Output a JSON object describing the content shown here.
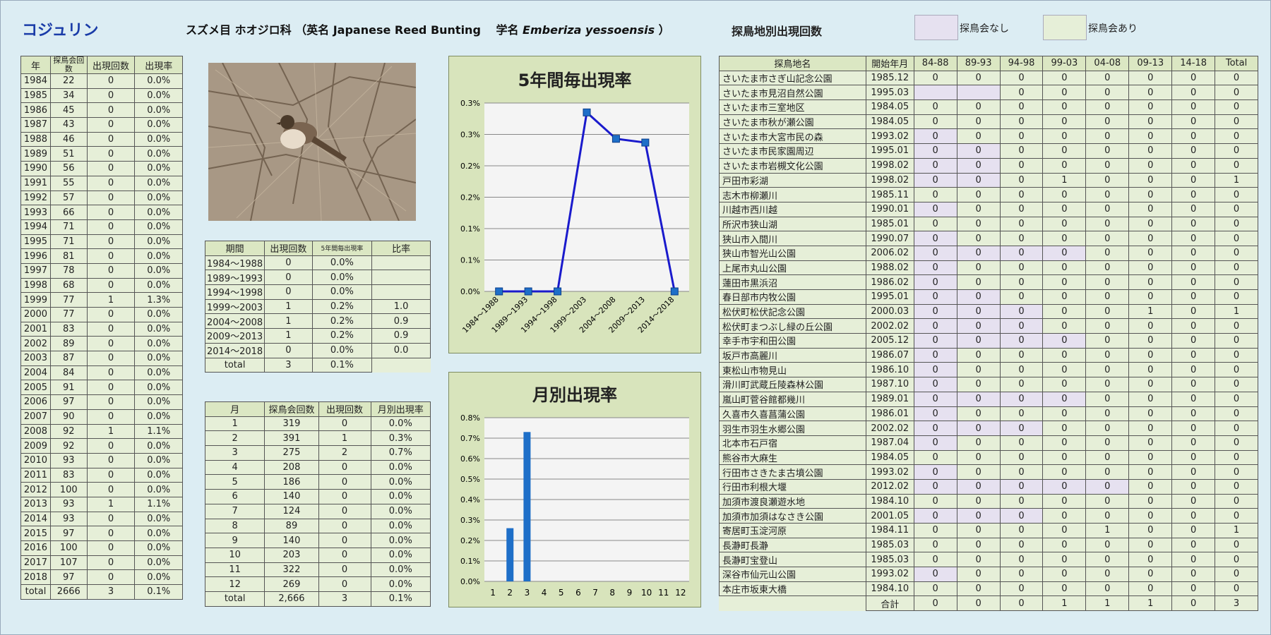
{
  "header": {
    "title": "コジュリン",
    "species_prefix": "スズメ目 ホオジロ科 （英名 Japanese Reed Bunting　 学名 ",
    "species_latin": "Emberiza yessoensis",
    "species_suffix": " ）",
    "loc_title": "探鳥地別出現回数",
    "legend_none": "探鳥会なし",
    "legend_yes": "探鳥会あり"
  },
  "colors": {
    "background": "#dcedf3",
    "table_cell": "#e6efd8",
    "no_survey": "#e6e1f0",
    "line": "#1a1acc",
    "marker": "#1e6fc8",
    "bar": "#1e6fc8",
    "panel": "#d8e4bc"
  },
  "year_table": {
    "headers": [
      "年",
      "探鳥会回数",
      "出現回数",
      "出現率"
    ],
    "rows": [
      [
        "1984",
        "22",
        "0",
        "0.0%"
      ],
      [
        "1985",
        "34",
        "0",
        "0.0%"
      ],
      [
        "1986",
        "45",
        "0",
        "0.0%"
      ],
      [
        "1987",
        "43",
        "0",
        "0.0%"
      ],
      [
        "1988",
        "46",
        "0",
        "0.0%"
      ],
      [
        "1989",
        "51",
        "0",
        "0.0%"
      ],
      [
        "1990",
        "56",
        "0",
        "0.0%"
      ],
      [
        "1991",
        "55",
        "0",
        "0.0%"
      ],
      [
        "1992",
        "57",
        "0",
        "0.0%"
      ],
      [
        "1993",
        "66",
        "0",
        "0.0%"
      ],
      [
        "1994",
        "71",
        "0",
        "0.0%"
      ],
      [
        "1995",
        "71",
        "0",
        "0.0%"
      ],
      [
        "1996",
        "81",
        "0",
        "0.0%"
      ],
      [
        "1997",
        "78",
        "0",
        "0.0%"
      ],
      [
        "1998",
        "68",
        "0",
        "0.0%"
      ],
      [
        "1999",
        "77",
        "1",
        "1.3%"
      ],
      [
        "2000",
        "77",
        "0",
        "0.0%"
      ],
      [
        "2001",
        "83",
        "0",
        "0.0%"
      ],
      [
        "2002",
        "89",
        "0",
        "0.0%"
      ],
      [
        "2003",
        "87",
        "0",
        "0.0%"
      ],
      [
        "2004",
        "84",
        "0",
        "0.0%"
      ],
      [
        "2005",
        "91",
        "0",
        "0.0%"
      ],
      [
        "2006",
        "97",
        "0",
        "0.0%"
      ],
      [
        "2007",
        "90",
        "0",
        "0.0%"
      ],
      [
        "2008",
        "92",
        "1",
        "1.1%"
      ],
      [
        "2009",
        "92",
        "0",
        "0.0%"
      ],
      [
        "2010",
        "93",
        "0",
        "0.0%"
      ],
      [
        "2011",
        "83",
        "0",
        "0.0%"
      ],
      [
        "2012",
        "100",
        "0",
        "0.0%"
      ],
      [
        "2013",
        "93",
        "1",
        "1.1%"
      ],
      [
        "2014",
        "93",
        "0",
        "0.0%"
      ],
      [
        "2015",
        "97",
        "0",
        "0.0%"
      ],
      [
        "2016",
        "100",
        "0",
        "0.0%"
      ],
      [
        "2017",
        "107",
        "0",
        "0.0%"
      ],
      [
        "2018",
        "97",
        "0",
        "0.0%"
      ],
      [
        "total",
        "2666",
        "3",
        "0.1%"
      ]
    ]
  },
  "period_table": {
    "headers": [
      "期間",
      "出現回数",
      "5年間毎出現率",
      "比率"
    ],
    "rows": [
      [
        "1984～1988",
        "0",
        "0.0%",
        ""
      ],
      [
        "1989～1993",
        "0",
        "0.0%",
        ""
      ],
      [
        "1994～1998",
        "0",
        "0.0%",
        ""
      ],
      [
        "1999～2003",
        "1",
        "0.2%",
        "1.0"
      ],
      [
        "2004～2008",
        "1",
        "0.2%",
        "0.9"
      ],
      [
        "2009～2013",
        "1",
        "0.2%",
        "0.9"
      ],
      [
        "2014～2018",
        "0",
        "0.0%",
        "0.0"
      ]
    ],
    "total": [
      "total",
      "3",
      "0.1%"
    ]
  },
  "month_table": {
    "headers": [
      "月",
      "探鳥会回数",
      "出現回数",
      "月別出現率"
    ],
    "rows": [
      [
        "1",
        "319",
        "0",
        "0.0%"
      ],
      [
        "2",
        "391",
        "1",
        "0.3%"
      ],
      [
        "3",
        "275",
        "2",
        "0.7%"
      ],
      [
        "4",
        "208",
        "0",
        "0.0%"
      ],
      [
        "5",
        "186",
        "0",
        "0.0%"
      ],
      [
        "6",
        "140",
        "0",
        "0.0%"
      ],
      [
        "7",
        "124",
        "0",
        "0.0%"
      ],
      [
        "8",
        "89",
        "0",
        "0.0%"
      ],
      [
        "9",
        "140",
        "0",
        "0.0%"
      ],
      [
        "10",
        "203",
        "0",
        "0.0%"
      ],
      [
        "11",
        "322",
        "0",
        "0.0%"
      ],
      [
        "12",
        "269",
        "0",
        "0.0%"
      ],
      [
        "total",
        "2,666",
        "3",
        "0.1%"
      ]
    ]
  },
  "location_table": {
    "headers": [
      "探鳥地名",
      "開始年月",
      "84-88",
      "89-93",
      "94-98",
      "99-03",
      "04-08",
      "09-13",
      "14-18",
      "Total"
    ],
    "rows": [
      {
        "name": "さいたま市さぎ山記念公園",
        "start": "1985.12",
        "v": [
          "0",
          "0",
          "0",
          "0",
          "0",
          "0",
          "0",
          "0"
        ],
        "p": []
      },
      {
        "name": "さいたま市見沼自然公園",
        "start": "1995.03",
        "v": [
          "",
          "",
          "0",
          "0",
          "0",
          "0",
          "0",
          "0"
        ],
        "p": [
          0,
          1
        ]
      },
      {
        "name": "さいたま市三室地区",
        "start": "1984.05",
        "v": [
          "0",
          "0",
          "0",
          "0",
          "0",
          "0",
          "0",
          "0"
        ],
        "p": []
      },
      {
        "name": "さいたま市秋が瀬公園",
        "start": "1984.05",
        "v": [
          "0",
          "0",
          "0",
          "0",
          "0",
          "0",
          "0",
          "0"
        ],
        "p": []
      },
      {
        "name": "さいたま市大宮市民の森",
        "start": "1993.02",
        "v": [
          "0",
          "0",
          "0",
          "0",
          "0",
          "0",
          "0",
          "0"
        ],
        "p": [
          0
        ]
      },
      {
        "name": "さいたま市民家園周辺",
        "start": "1995.01",
        "v": [
          "0",
          "0",
          "0",
          "0",
          "0",
          "0",
          "0",
          "0"
        ],
        "p": [
          0,
          1
        ]
      },
      {
        "name": "さいたま市岩槻文化公園",
        "start": "1998.02",
        "v": [
          "0",
          "0",
          "0",
          "0",
          "0",
          "0",
          "0",
          "0"
        ],
        "p": [
          0,
          1
        ]
      },
      {
        "name": "戸田市彩湖",
        "start": "1998.02",
        "v": [
          "0",
          "0",
          "0",
          "1",
          "0",
          "0",
          "0",
          "1"
        ],
        "p": [
          0,
          1
        ]
      },
      {
        "name": "志木市柳瀬川",
        "start": "1985.11",
        "v": [
          "0",
          "0",
          "0",
          "0",
          "0",
          "0",
          "0",
          "0"
        ],
        "p": []
      },
      {
        "name": "川越市西川越",
        "start": "1990.01",
        "v": [
          "0",
          "0",
          "0",
          "0",
          "0",
          "0",
          "0",
          "0"
        ],
        "p": [
          0
        ]
      },
      {
        "name": "所沢市狭山湖",
        "start": "1985.01",
        "v": [
          "0",
          "0",
          "0",
          "0",
          "0",
          "0",
          "0",
          "0"
        ],
        "p": []
      },
      {
        "name": "狭山市入間川",
        "start": "1990.07",
        "v": [
          "0",
          "0",
          "0",
          "0",
          "0",
          "0",
          "0",
          "0"
        ],
        "p": [
          0
        ]
      },
      {
        "name": "狭山市智光山公園",
        "start": "2006.02",
        "v": [
          "0",
          "0",
          "0",
          "0",
          "0",
          "0",
          "0",
          "0"
        ],
        "p": [
          0,
          1,
          2,
          3
        ]
      },
      {
        "name": "上尾市丸山公園",
        "start": "1988.02",
        "v": [
          "0",
          "0",
          "0",
          "0",
          "0",
          "0",
          "0",
          "0"
        ],
        "p": [
          0
        ]
      },
      {
        "name": "蓮田市黒浜沼",
        "start": "1986.02",
        "v": [
          "0",
          "0",
          "0",
          "0",
          "0",
          "0",
          "0",
          "0"
        ],
        "p": [
          0
        ]
      },
      {
        "name": "春日部市内牧公園",
        "start": "1995.01",
        "v": [
          "0",
          "0",
          "0",
          "0",
          "0",
          "0",
          "0",
          "0"
        ],
        "p": [
          0,
          1
        ]
      },
      {
        "name": "松伏町松伏記念公園",
        "start": "2000.03",
        "v": [
          "0",
          "0",
          "0",
          "0",
          "0",
          "1",
          "0",
          "1"
        ],
        "p": [
          0,
          1,
          2
        ]
      },
      {
        "name": "松伏町まつぶし緑の丘公園",
        "start": "2002.02",
        "v": [
          "0",
          "0",
          "0",
          "0",
          "0",
          "0",
          "0",
          "0"
        ],
        "p": [
          0,
          1,
          2
        ]
      },
      {
        "name": "幸手市宇和田公園",
        "start": "2005.12",
        "v": [
          "0",
          "0",
          "0",
          "0",
          "0",
          "0",
          "0",
          "0"
        ],
        "p": [
          0,
          1,
          2,
          3
        ]
      },
      {
        "name": "坂戸市高麗川",
        "start": "1986.07",
        "v": [
          "0",
          "0",
          "0",
          "0",
          "0",
          "0",
          "0",
          "0"
        ],
        "p": [
          0
        ]
      },
      {
        "name": "東松山市物見山",
        "start": "1986.10",
        "v": [
          "0",
          "0",
          "0",
          "0",
          "0",
          "0",
          "0",
          "0"
        ],
        "p": [
          0
        ]
      },
      {
        "name": "滑川町武蔵丘陵森林公園",
        "start": "1987.10",
        "v": [
          "0",
          "0",
          "0",
          "0",
          "0",
          "0",
          "0",
          "0"
        ],
        "p": [
          0
        ]
      },
      {
        "name": "嵐山町菅谷館都幾川",
        "start": "1989.01",
        "v": [
          "0",
          "0",
          "0",
          "0",
          "0",
          "0",
          "0",
          "0"
        ],
        "p": [
          0,
          1,
          2,
          3
        ]
      },
      {
        "name": "久喜市久喜菖蒲公園",
        "start": "1986.01",
        "v": [
          "0",
          "0",
          "0",
          "0",
          "0",
          "0",
          "0",
          "0"
        ],
        "p": [
          0
        ]
      },
      {
        "name": "羽生市羽生水郷公園",
        "start": "2002.02",
        "v": [
          "0",
          "0",
          "0",
          "0",
          "0",
          "0",
          "0",
          "0"
        ],
        "p": [
          0,
          1,
          2
        ]
      },
      {
        "name": "北本市石戸宿",
        "start": "1987.04",
        "v": [
          "0",
          "0",
          "0",
          "0",
          "0",
          "0",
          "0",
          "0"
        ],
        "p": [
          0
        ]
      },
      {
        "name": "熊谷市大麻生",
        "start": "1984.05",
        "v": [
          "0",
          "0",
          "0",
          "0",
          "0",
          "0",
          "0",
          "0"
        ],
        "p": []
      },
      {
        "name": "行田市さきたま古墳公園",
        "start": "1993.02",
        "v": [
          "0",
          "0",
          "0",
          "0",
          "0",
          "0",
          "0",
          "0"
        ],
        "p": [
          0
        ]
      },
      {
        "name": "行田市利根大堰",
        "start": "2012.02",
        "v": [
          "0",
          "0",
          "0",
          "0",
          "0",
          "0",
          "0",
          "0"
        ],
        "p": [
          0,
          1,
          2,
          3,
          4
        ]
      },
      {
        "name": "加須市渡良瀬遊水地",
        "start": "1984.10",
        "v": [
          "0",
          "0",
          "0",
          "0",
          "0",
          "0",
          "0",
          "0"
        ],
        "p": []
      },
      {
        "name": "加須市加須はなさき公園",
        "start": "2001.05",
        "v": [
          "0",
          "0",
          "0",
          "0",
          "0",
          "0",
          "0",
          "0"
        ],
        "p": [
          0,
          1,
          2
        ]
      },
      {
        "name": "寄居町玉淀河原",
        "start": "1984.11",
        "v": [
          "0",
          "0",
          "0",
          "0",
          "1",
          "0",
          "0",
          "1"
        ],
        "p": []
      },
      {
        "name": "長瀞町長瀞",
        "start": "1985.03",
        "v": [
          "0",
          "0",
          "0",
          "0",
          "0",
          "0",
          "0",
          "0"
        ],
        "p": []
      },
      {
        "name": "長瀞町宝登山",
        "start": "1985.03",
        "v": [
          "0",
          "0",
          "0",
          "0",
          "0",
          "0",
          "0",
          "0"
        ],
        "p": []
      },
      {
        "name": "深谷市仙元山公園",
        "start": "1993.02",
        "v": [
          "0",
          "0",
          "0",
          "0",
          "0",
          "0",
          "0",
          "0"
        ],
        "p": [
          0
        ]
      },
      {
        "name": "本庄市坂東大橋",
        "start": "1984.10",
        "v": [
          "0",
          "0",
          "0",
          "0",
          "0",
          "0",
          "0",
          "0"
        ],
        "p": []
      }
    ],
    "total_label": "合計",
    "totals": [
      "0",
      "0",
      "0",
      "1",
      "1",
      "1",
      "0",
      "3"
    ]
  },
  "chart_data": [
    {
      "type": "line",
      "title": "5年間毎出現率",
      "categories": [
        "1984～1988",
        "1989～1993",
        "1994～1998",
        "1999～2003",
        "2004～2008",
        "2009～2013",
        "2014～2018"
      ],
      "values": [
        0.0,
        0.0,
        0.0,
        0.285,
        0.243,
        0.237,
        0.0
      ],
      "ylim": [
        0,
        0.3
      ],
      "yticks": [
        "0.0%",
        "0.1%",
        "0.1%",
        "0.2%",
        "0.2%",
        "0.3%",
        "0.3%"
      ],
      "grid": true
    },
    {
      "type": "bar",
      "title": "月別出現率",
      "categories": [
        "1",
        "2",
        "3",
        "4",
        "5",
        "6",
        "7",
        "8",
        "9",
        "10",
        "11",
        "12"
      ],
      "values": [
        0,
        0.26,
        0.73,
        0,
        0,
        0,
        0,
        0,
        0,
        0,
        0,
        0
      ],
      "ylim": [
        0,
        0.8
      ],
      "yticks": [
        "0.0%",
        "0.1%",
        "0.2%",
        "0.3%",
        "0.4%",
        "0.5%",
        "0.6%",
        "0.7%",
        "0.8%"
      ],
      "grid": true
    }
  ]
}
